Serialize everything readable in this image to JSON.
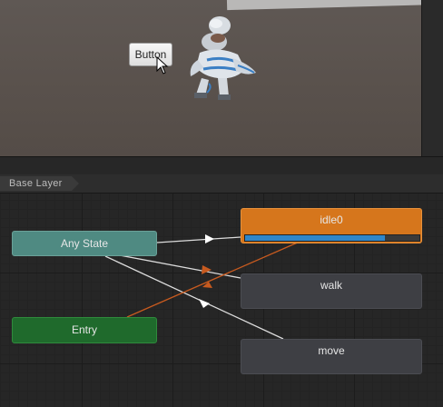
{
  "scene": {
    "button_label": "Button"
  },
  "breadcrumb": {
    "layer": "Base Layer"
  },
  "states": {
    "any_state": "Any State",
    "entry": "Entry",
    "idle": "idle0",
    "walk": "walk",
    "move": "move"
  },
  "idle_progress": 0.8,
  "colors": {
    "any_state": "#4f8a82",
    "entry": "#1f6a2c",
    "default_state": "#d6761c",
    "state": "#3e3f44",
    "progress": "#2f86c9",
    "transition": "#dcdcdc",
    "active_transition": "#c75a1f"
  }
}
